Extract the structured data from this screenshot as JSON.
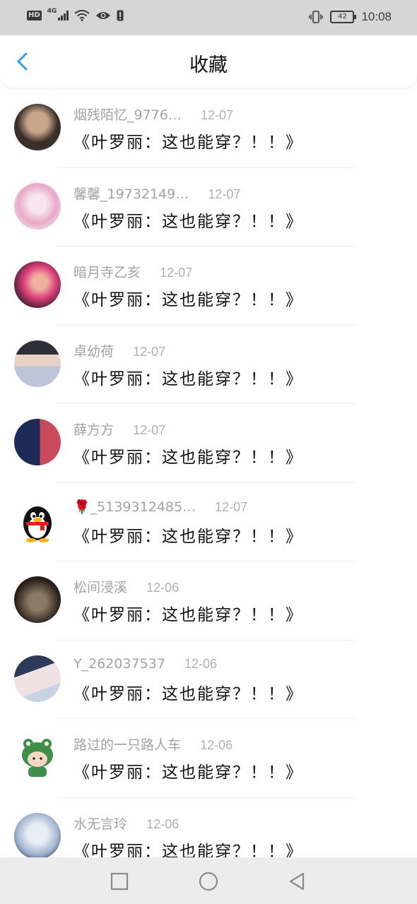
{
  "status_bar": {
    "network_badge": "HD",
    "network_type": "4G",
    "battery": "42",
    "time": "10:08"
  },
  "header": {
    "title": "收藏"
  },
  "items": [
    {
      "username": "烟残陌忆_9776…",
      "date": "12-07",
      "content": "《叶罗丽：这也能穿？！！》",
      "avatar_colors": [
        "#3b2f2a",
        "#c9a58a"
      ]
    },
    {
      "username": "馨馨_19732149…",
      "date": "12-07",
      "content": "《叶罗丽：这也能穿？！！》",
      "avatar_colors": [
        "#f3d6e6",
        "#e9a9c9"
      ]
    },
    {
      "username": "暗月寺乙亥",
      "date": "12-07",
      "content": "《叶罗丽：这也能穿？！！》",
      "avatar_colors": [
        "#4a1c36",
        "#d9407a"
      ]
    },
    {
      "username": "卓幼荷",
      "date": "12-07",
      "content": "《叶罗丽：这也能穿？！！》",
      "avatar_colors": [
        "#2e2e38",
        "#bfc5d9"
      ]
    },
    {
      "username": "薛方方",
      "date": "12-07",
      "content": "《叶罗丽：这也能穿？！！》",
      "avatar_colors": [
        "#1c2a55",
        "#c94a5a"
      ]
    },
    {
      "username": "🌹_5139312485…",
      "date": "12-07",
      "content": "《叶罗丽：这也能穿？！！》",
      "avatar_colors": [
        "#ffffff",
        "#000000"
      ]
    },
    {
      "username": "松间浸溪",
      "date": "12-06",
      "content": "《叶罗丽：这也能穿？！！》",
      "avatar_colors": [
        "#2a1f18",
        "#8a7a66"
      ]
    },
    {
      "username": "Y_262037537",
      "date": "12-06",
      "content": "《叶罗丽：这也能穿？！！》",
      "avatar_colors": [
        "#2d3a5a",
        "#e6dde0"
      ]
    },
    {
      "username": "路过的一只路人车",
      "date": "12-06",
      "content": "《叶罗丽：这也能穿？！！》",
      "avatar_colors": [
        "#3f8f4a",
        "#f2d7c4"
      ]
    },
    {
      "username": "水无言玲",
      "date": "12-06",
      "content": "《叶罗丽：这也能穿？！！》",
      "avatar_colors": [
        "#9fb3cf",
        "#e8eef6"
      ]
    }
  ],
  "colors": {
    "accent": "#2f9af0",
    "status_bar_bg": "#d6d6d6",
    "nav_bar_bg": "#ececec"
  },
  "icons": {
    "back": "chevron-left-icon",
    "nav_square": "recent-apps-icon",
    "nav_circle": "home-icon",
    "nav_triangle": "back-triangle-icon"
  }
}
